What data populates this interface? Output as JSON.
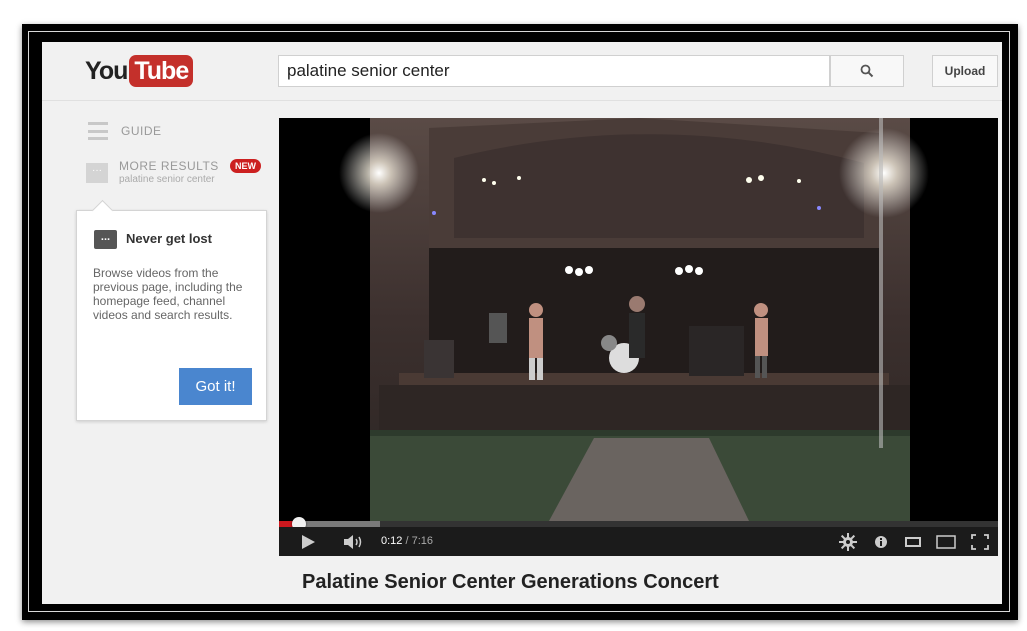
{
  "header": {
    "logo_you": "You",
    "logo_tube": "Tube",
    "search_value": "palatine senior center",
    "upload_label": "Upload"
  },
  "sidebar": {
    "guide_label": "GUIDE",
    "more_results_label": "MORE RESULTS",
    "new_badge": "NEW",
    "more_results_query": "palatine senior center",
    "tooltip": {
      "icon_text": "...",
      "title": "Never get lost",
      "body": "Browse videos from the previous page, including the homepage feed, channel videos and search results.",
      "button_label": "Got it!"
    }
  },
  "player": {
    "current_time": "0:12",
    "duration_text": "/ 7:16",
    "played_fraction": 0.0275,
    "buffered_fraction": 0.14
  },
  "video": {
    "title": "Palatine Senior Center Generations Concert"
  },
  "colors": {
    "brand_red": "#c4302b",
    "got_it_blue": "#4a86cf",
    "progress_red": "#cc181e",
    "new_badge_red": "#cc2020"
  },
  "icons": [
    "search-icon",
    "guide-icon",
    "more-results-icon",
    "play-icon",
    "volume-icon",
    "settings-icon",
    "info-icon",
    "small-player-icon",
    "large-player-icon",
    "fullscreen-icon"
  ]
}
